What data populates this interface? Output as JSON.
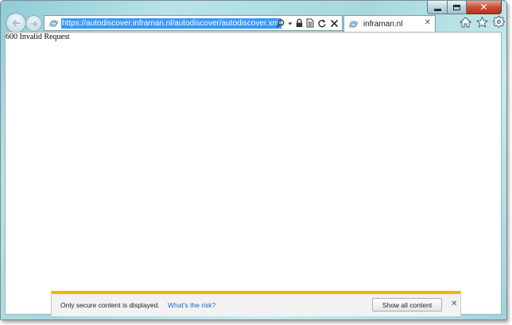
{
  "browser": {
    "address_url": "https://autodiscover.inframan.nl/autodiscover/autodiscover.xml",
    "tab_title": "inframan.nl",
    "tab_close_glyph": "✕",
    "caption_close_glyph": "✕",
    "icons": {
      "back": "back-arrow-icon",
      "forward": "forward-arrow-icon",
      "site": "internet-explorer-icon",
      "search": "search-icon",
      "dropdown": "dropdown-arrow-icon",
      "lock": "lock-icon",
      "compat": "compatibility-view-icon",
      "refresh": "refresh-icon",
      "stop": "stop-icon",
      "home": "home-icon",
      "favorites": "star-icon",
      "tools": "gear-icon"
    }
  },
  "page": {
    "body_text": "600 Invalid Request"
  },
  "notification": {
    "message": "Only secure content is displayed.",
    "link_text": "What's the risk?",
    "button_label": "Show all content",
    "close_glyph": "✕",
    "accent_color": "#f5b400",
    "link_color": "#1e66c9"
  },
  "colors": {
    "url_highlight": "#3399ff",
    "frame": "#a6d8dd"
  }
}
